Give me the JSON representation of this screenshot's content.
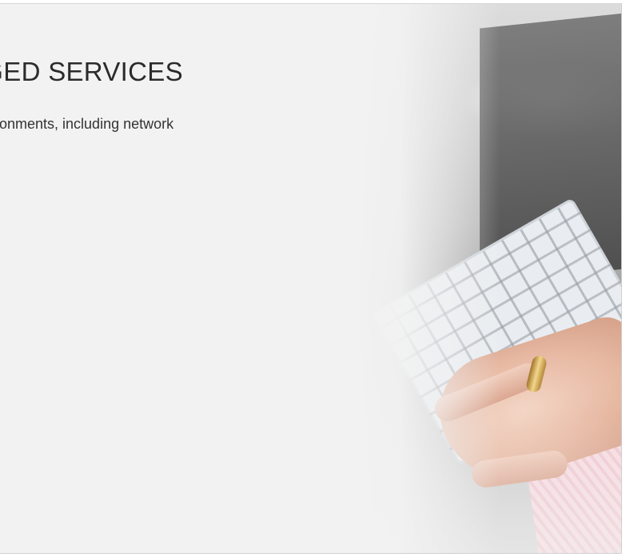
{
  "hero": {
    "heading": "AGED SERVICES",
    "description": "onments, including network",
    "image_alt": "hand-typing-on-keyboard-photo"
  },
  "colors": {
    "panel_background": "#f2f2f2",
    "heading_text": "#2b2b2b",
    "body_text": "#333333"
  }
}
